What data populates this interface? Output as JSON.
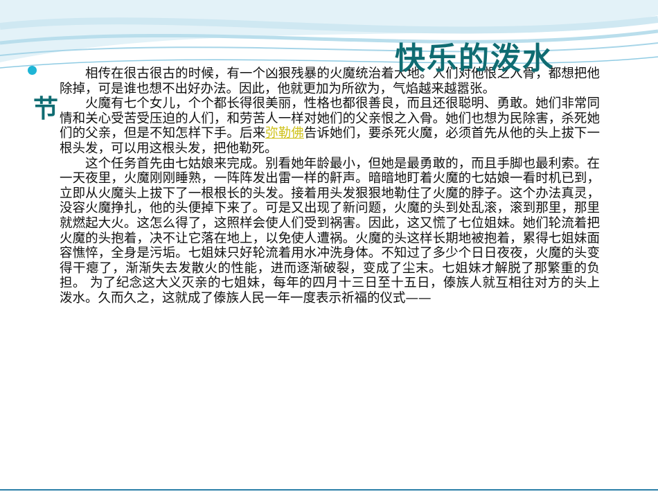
{
  "slide": {
    "title_part1": "快乐的泼水",
    "title_part2": "节",
    "accent_color": "#0f6c72",
    "paragraphs": [
      {
        "text": "相传在很古很古的时候，有一个凶狠残暴的火魔统治着大地。人们对他恨之入骨，都想把他除掉，可是谁也想不出好办法。因此，他就更加为所欲为，气焰越来越嚣张。"
      },
      {
        "before": "火魔有七个女儿，个个都长得很美丽，性格也都很善良，而且还很聪明、勇敢。她们非常同情和关心受苦受压迫的人们，和劳苦人一样对她们的父亲恨之入骨。她们也想为民除害，杀死她们的父亲，但是不知怎样下手。后来",
        "link": "弥勒佛",
        "after": "告诉她们，要杀死火魔，必须首先从他的头上拔下一根头发，可以用这根头发，把他勒死。"
      },
      {
        "text": "这个任务首先由七姑娘来完成。别看她年龄最小，但她是最勇敢的，而且手脚也最利索。在一天夜里，火魔刚刚睡熟，一阵阵发出雷一样的鼾声。暗暗地盯着火魔的七姑娘一看时机已到，立即从火魔头上拔下了一根根长的头发。接着用头发狠狠地勒住了火魔的脖子。这个办法真灵，没容火魔挣扎，他的头便掉下来了。可是又出现了新问题，火魔的头到处乱滚，滚到那里，那里就燃起大火。这怎么得了，这照样会使人们受到祸害。因此，这又慌了七位姐妹。她们轮流着把火魔的头抱着，决不让它落在地上，以免使人遭祸。火魔的头这样长期地被抱着，累得七姐妹面容憔悴，全身是污垢。七姐妹只好轮流着用水冲洗身体。不知过了多少个日日夜夜，火魔的头变得干瘪了，渐渐失去发散火的性能，进而逐渐破裂，变成了尘末。七姐妹才解脱了那繁重的负担。 为了纪念这大义灭亲的七姐妹，每年的四月十三日至十五日，傣族人就互相往对方的头上泼水。久而久之，这就成了傣族人民一年一度表示祈福的仪式——"
      }
    ]
  }
}
